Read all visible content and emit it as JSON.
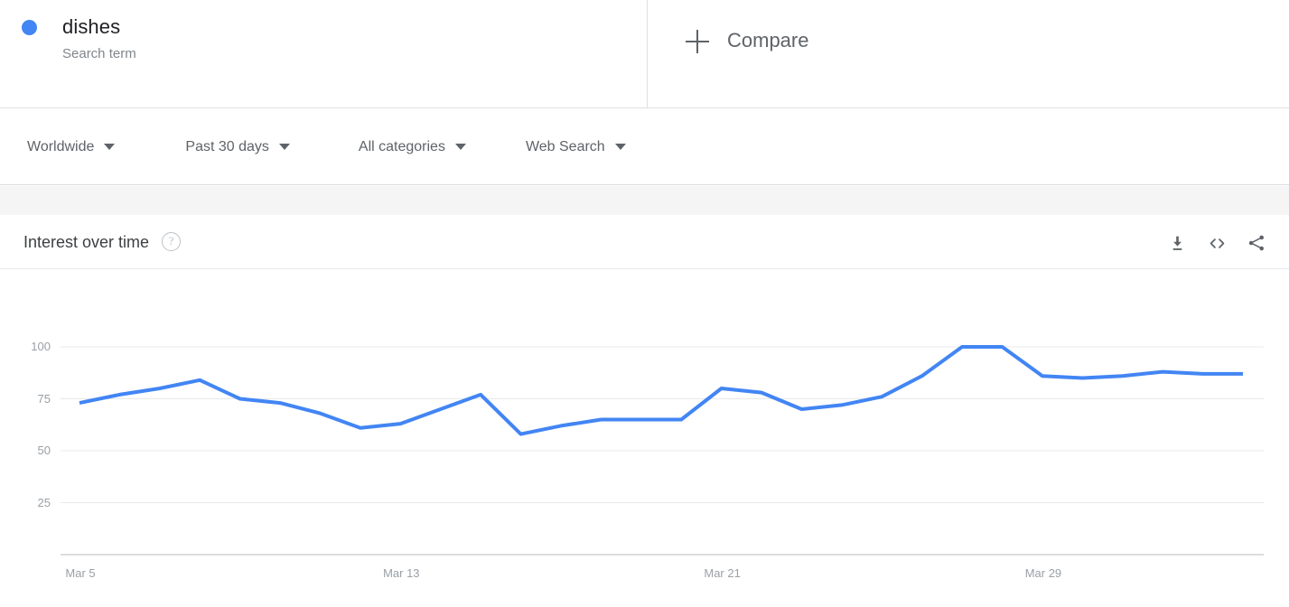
{
  "term": {
    "name": "dishes",
    "type_label": "Search term",
    "dot_color": "#4285f4"
  },
  "compare": {
    "label": "Compare",
    "icon": "plus-icon"
  },
  "filters": [
    {
      "label": "Worldwide",
      "name": "location"
    },
    {
      "label": "Past 30 days",
      "name": "time-range"
    },
    {
      "label": "All categories",
      "name": "category"
    },
    {
      "label": "Web Search",
      "name": "search-type"
    }
  ],
  "card": {
    "title": "Interest over time",
    "help_icon": "help-circle-icon",
    "help_glyph": "?",
    "actions": [
      {
        "name": "download-csv-button",
        "icon": "download-icon"
      },
      {
        "name": "embed-button",
        "icon": "code-embed-icon"
      },
      {
        "name": "share-button",
        "icon": "share-icon"
      }
    ]
  },
  "chart_data": {
    "type": "line",
    "title": "Interest over time",
    "xlabel": "",
    "ylabel": "",
    "ylim": [
      0,
      100
    ],
    "yticks": [
      25,
      50,
      75,
      100
    ],
    "grid": true,
    "legend_position": "top",
    "line_color": "#4285f4",
    "line_width": 4,
    "x_tick_labels": [
      "Mar 5",
      "Mar 13",
      "Mar 21",
      "Mar 29"
    ],
    "x_tick_indices": [
      0,
      8,
      16,
      24
    ],
    "x": [
      "Mar 5",
      "Mar 6",
      "Mar 7",
      "Mar 8",
      "Mar 9",
      "Mar 10",
      "Mar 11",
      "Mar 12",
      "Mar 13",
      "Mar 14",
      "Mar 15",
      "Mar 16",
      "Mar 17",
      "Mar 18",
      "Mar 19",
      "Mar 20",
      "Mar 21",
      "Mar 22",
      "Mar 23",
      "Mar 24",
      "Mar 25",
      "Mar 26",
      "Mar 27",
      "Mar 28",
      "Mar 29",
      "Mar 30",
      "Mar 31",
      "Apr 1",
      "Apr 2",
      "Apr 3"
    ],
    "series": [
      {
        "name": "dishes",
        "values": [
          73,
          77,
          80,
          84,
          75,
          73,
          68,
          61,
          63,
          70,
          77,
          58,
          62,
          65,
          65,
          65,
          80,
          78,
          70,
          72,
          76,
          86,
          100,
          100,
          86,
          85,
          86,
          88,
          87,
          87
        ]
      }
    ]
  }
}
